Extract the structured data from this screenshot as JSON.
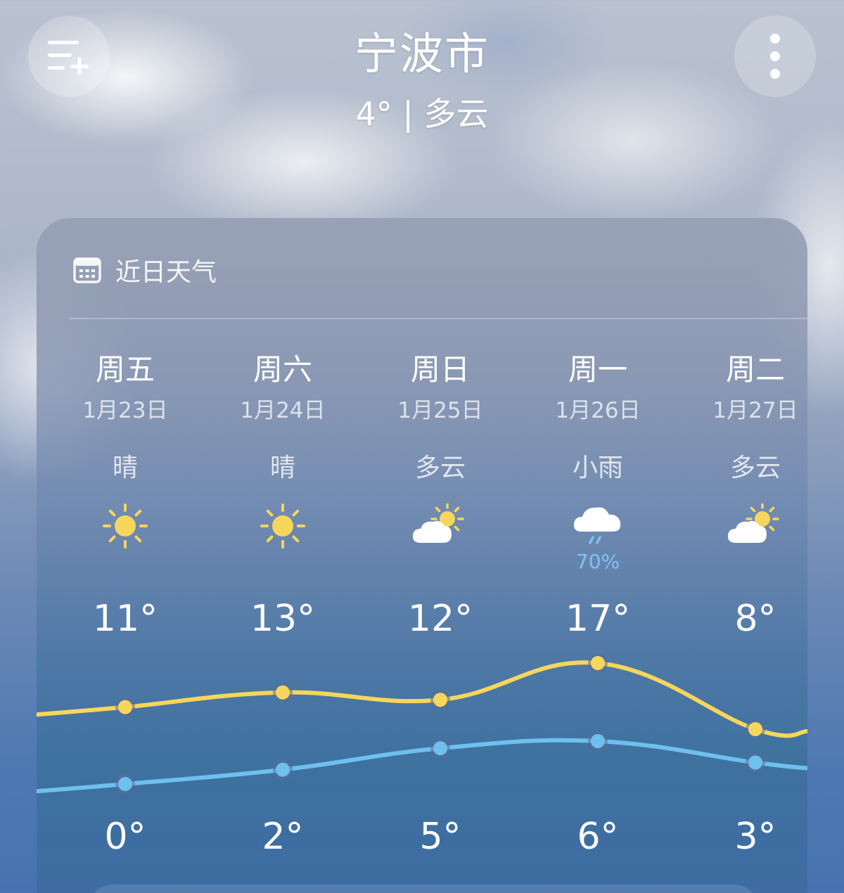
{
  "header": {
    "city": "宁波市",
    "current": "4° | 多云"
  },
  "card": {
    "title": "近日天气"
  },
  "days": [
    {
      "name": "周五",
      "date": "1月23日",
      "condition": "晴",
      "icon": "sun-icon",
      "high": "11°",
      "low": "0°",
      "precip": ""
    },
    {
      "name": "周六",
      "date": "1月24日",
      "condition": "晴",
      "icon": "sun-icon",
      "high": "13°",
      "low": "2°",
      "precip": ""
    },
    {
      "name": "周日",
      "date": "1月25日",
      "condition": "多云",
      "icon": "partly-cloudy-icon",
      "high": "12°",
      "low": "5°",
      "precip": ""
    },
    {
      "name": "周一",
      "date": "1月26日",
      "condition": "小雨",
      "icon": "light-rain-icon",
      "high": "17°",
      "low": "6°",
      "precip": "70%"
    },
    {
      "name": "周二",
      "date": "1月27日",
      "condition": "多云",
      "icon": "partly-cloudy-icon",
      "high": "8°",
      "low": "3°",
      "precip": ""
    }
  ],
  "chart_data": {
    "type": "line",
    "categories": [
      "周五",
      "周六",
      "周日",
      "周一",
      "周二"
    ],
    "series": [
      {
        "name": "",
        "values": [
          11,
          13,
          12,
          17,
          8
        ],
        "color": "#f7d65c"
      },
      {
        "name": "",
        "values": [
          0,
          2,
          5,
          6,
          3
        ],
        "color": "#6ec0ee"
      }
    ]
  },
  "colors": {
    "high_line": "#f7d65c",
    "low_line": "#6ec0ee",
    "sun": "#f7d65c",
    "rain": "#7dc4f0"
  }
}
